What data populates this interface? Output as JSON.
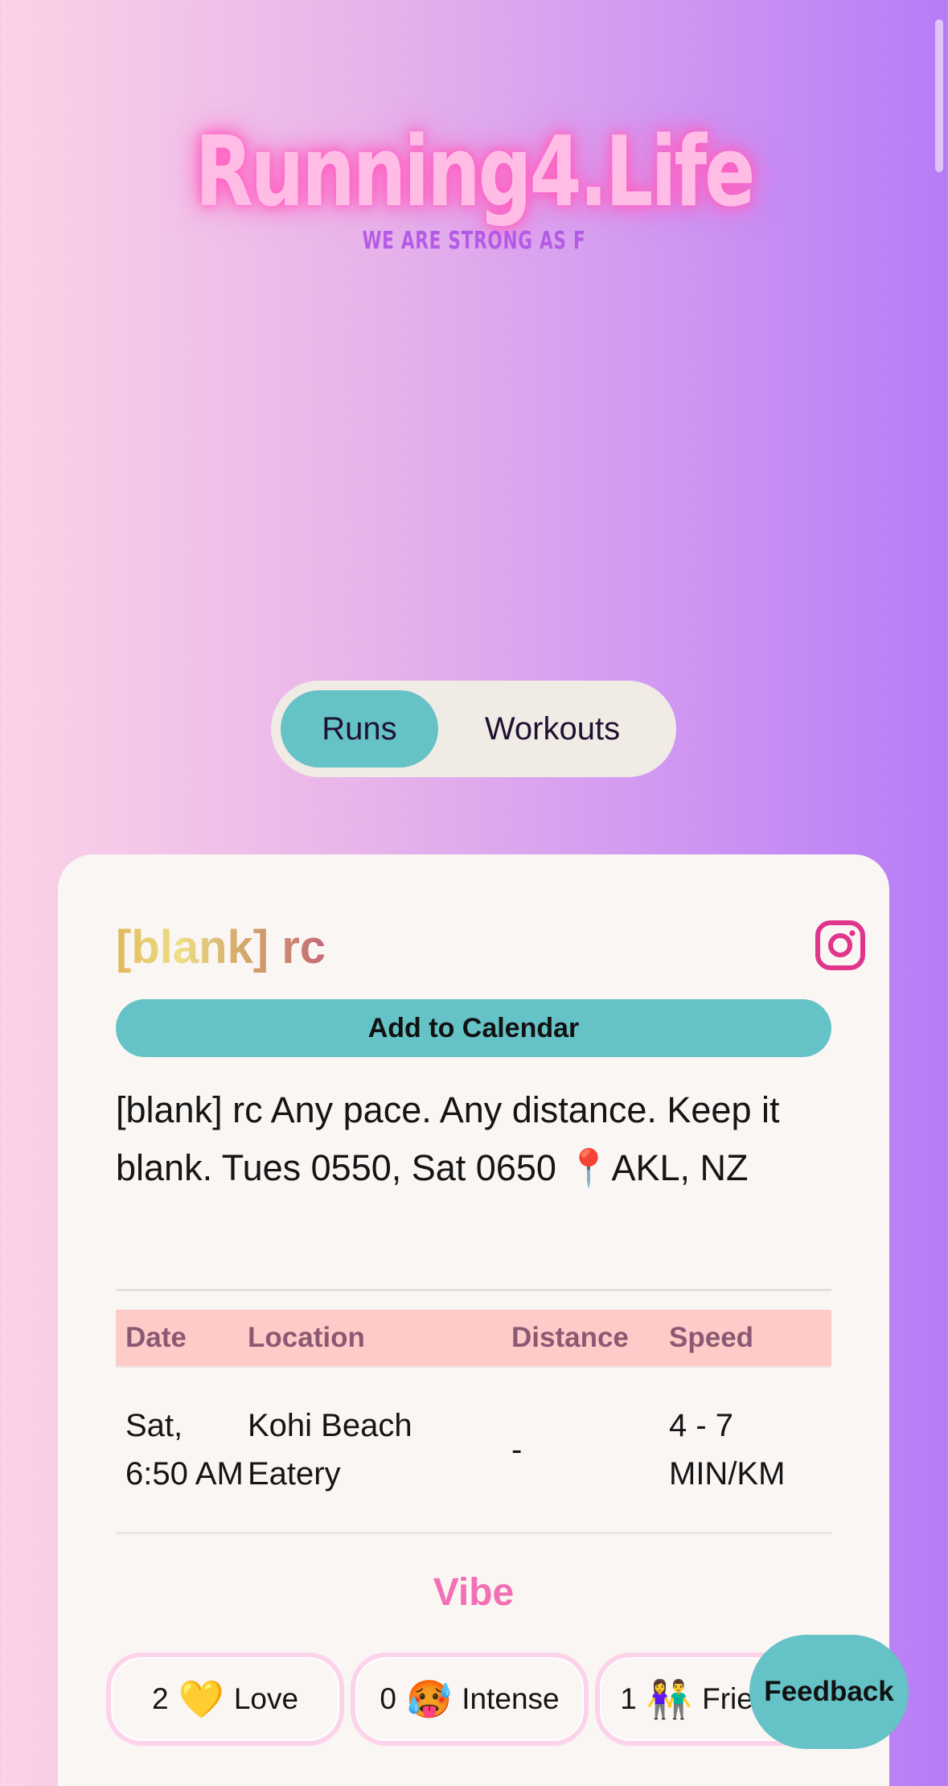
{
  "brand": {
    "logo": "Running4.Life",
    "tagline": "WE ARE STRONG AS F"
  },
  "tabs": {
    "runs": "Runs",
    "workouts": "Workouts",
    "active": "Runs"
  },
  "club": {
    "name": "[blank] rc",
    "calendar_button": "Add to Calendar",
    "description": "[blank] rc Any pace. Any distance. Keep it blank. Tues 0550, Sat 0650 📍AKL, NZ",
    "social_icon": "instagram-icon"
  },
  "schedule": {
    "headers": [
      "Date",
      "Location",
      "Distance",
      "Speed"
    ],
    "rows": [
      {
        "date": "Sat, 6:50 AM",
        "location": "Kohi Beach Eatery",
        "distance": "-",
        "speed": "4 - 7 MIN/KM"
      }
    ]
  },
  "vibe": {
    "title": "Vibe",
    "items": [
      {
        "count": "2",
        "emoji": "💛",
        "label": "Love"
      },
      {
        "count": "0",
        "emoji": "🥵",
        "label": "Intense"
      },
      {
        "count": "1",
        "emoji": "👫",
        "label": "Friendly"
      }
    ]
  },
  "feedback_button": "Feedback",
  "colors": {
    "accent_teal": "#65c2c6",
    "vibe_pink": "#f36fb6",
    "table_header_bg": "#ffcbc8",
    "instagram": "#e0358b"
  }
}
